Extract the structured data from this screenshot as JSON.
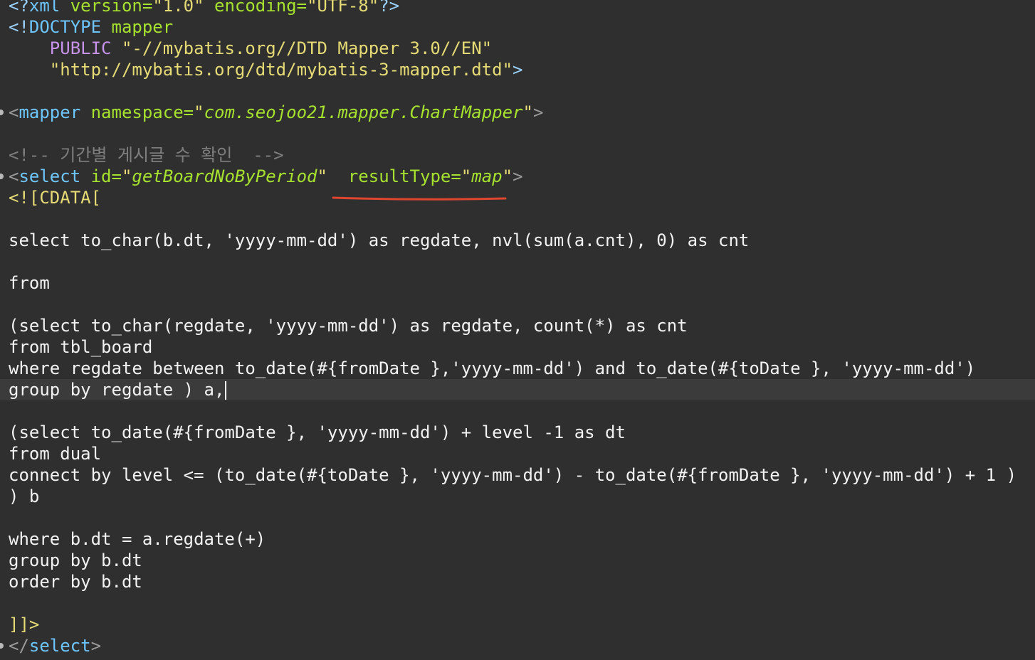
{
  "editor": {
    "line1": {
      "open": "<?",
      "name": "xml",
      "a1": " version=",
      "v1": "\"1.0\"",
      "a2": " encoding=",
      "v2": "\"UTF-8\"",
      "close": "?>"
    },
    "line2": {
      "open": "<!",
      "name": "DOCTYPE",
      "rest": " mapper"
    },
    "line3": {
      "indent": "    ",
      "kw": "PUBLIC",
      "str": " \"-//mybatis.org//DTD Mapper 3.0//EN\""
    },
    "line4": {
      "indent": "    ",
      "str": "\"http://mybatis.org/dtd/mybatis-3-mapper.dtd\"",
      "close": ">"
    },
    "line6": {
      "open": "<",
      "tag": "mapper",
      "attr": " namespace=",
      "q1": "\"",
      "val": "com.seojoo21.mapper.ChartMapper",
      "q2": "\"",
      "close": ">"
    },
    "line8": {
      "comment": "<!-- 기간별 게시글 수 확인  -->"
    },
    "line9": {
      "open": "<",
      "tag": "select",
      "attr1": " id=",
      "q1": "\"",
      "val1": "getBoardNoByPeriod",
      "q2": "\"",
      "attr2": "  resultType=",
      "q3": "\"",
      "val2": "map",
      "q4": "\"",
      "close": ">"
    },
    "line10": {
      "text": "<![CDATA["
    },
    "line12": {
      "text": "select to_char(b.dt, 'yyyy-mm-dd') as regdate, nvl(sum(a.cnt), 0) as cnt"
    },
    "line14": {
      "text": "from"
    },
    "line16": {
      "text": "(select to_char(regdate, 'yyyy-mm-dd') as regdate, count(*) as cnt"
    },
    "line17": {
      "text": "from tbl_board"
    },
    "line18": {
      "text": "where regdate between to_date(#{fromDate },'yyyy-mm-dd') and to_date(#{toDate }, 'yyyy-mm-dd')"
    },
    "line19": {
      "text": "group by regdate ) a,"
    },
    "line21": {
      "text": "(select to_date(#{fromDate }, 'yyyy-mm-dd') + level -1 as dt"
    },
    "line22": {
      "text": "from dual"
    },
    "line23": {
      "text": "connect by level <= (to_date(#{toDate }, 'yyyy-mm-dd') - to_date(#{fromDate }, 'yyyy-mm-dd') + 1 )"
    },
    "line24": {
      "text": ") b"
    },
    "line26": {
      "text": "where b.dt = a.regdate(+)"
    },
    "line27": {
      "text": "group by b.dt"
    },
    "line28": {
      "text": "order by b.dt"
    },
    "line30": {
      "text": "]]>"
    },
    "line31": {
      "open": "</",
      "tag": "select",
      "close": ">"
    }
  },
  "colors": {
    "background": "#2f2f2f",
    "tag": "#6ec6ff",
    "attribute": "#a6e22e",
    "string": "#e6db74",
    "keyword": "#c792ea",
    "comment": "#7f7f7f",
    "annotation_underline": "#e0452f"
  }
}
